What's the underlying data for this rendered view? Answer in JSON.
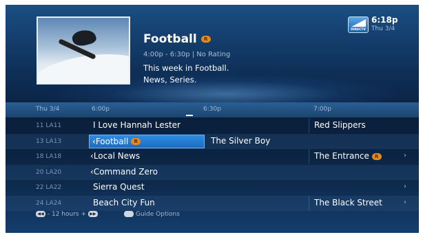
{
  "program": {
    "title": "Football",
    "badge": "R",
    "time_rating": "4:00p - 6:30p  |  No Rating",
    "description_line1": "This week in Football.",
    "description_line2": "News, Series."
  },
  "clock": {
    "time": "6:18p",
    "date": "Thu 3/4",
    "brand": "DIRECTV"
  },
  "guide_header": {
    "date": "Thu 3/4",
    "slot1": "6:00p",
    "slot2": "6:30p",
    "slot3": "7:00p"
  },
  "rows": [
    {
      "channel": "11 LA11",
      "shows": [
        "I Love Hannah Lester",
        "Red Slippers"
      ]
    },
    {
      "channel": "13 LA13",
      "shows": [
        "Football",
        "The Silver Boy"
      ]
    },
    {
      "channel": "18 LA18",
      "shows": [
        "Local News",
        "The Entrance"
      ]
    },
    {
      "channel": "20 LA20",
      "shows": [
        "Command Zero"
      ]
    },
    {
      "channel": "22 LA22",
      "shows": [
        "Sierra Quest"
      ]
    },
    {
      "channel": "24 LA24",
      "shows": [
        "Beach City Fun",
        "The Black Street"
      ]
    }
  ],
  "footer": {
    "hours_text": "- 12 hours +",
    "options_text": "Guide Options"
  },
  "colors": {
    "accent": "#1b6cc3",
    "record_badge": "#e48a1a"
  }
}
